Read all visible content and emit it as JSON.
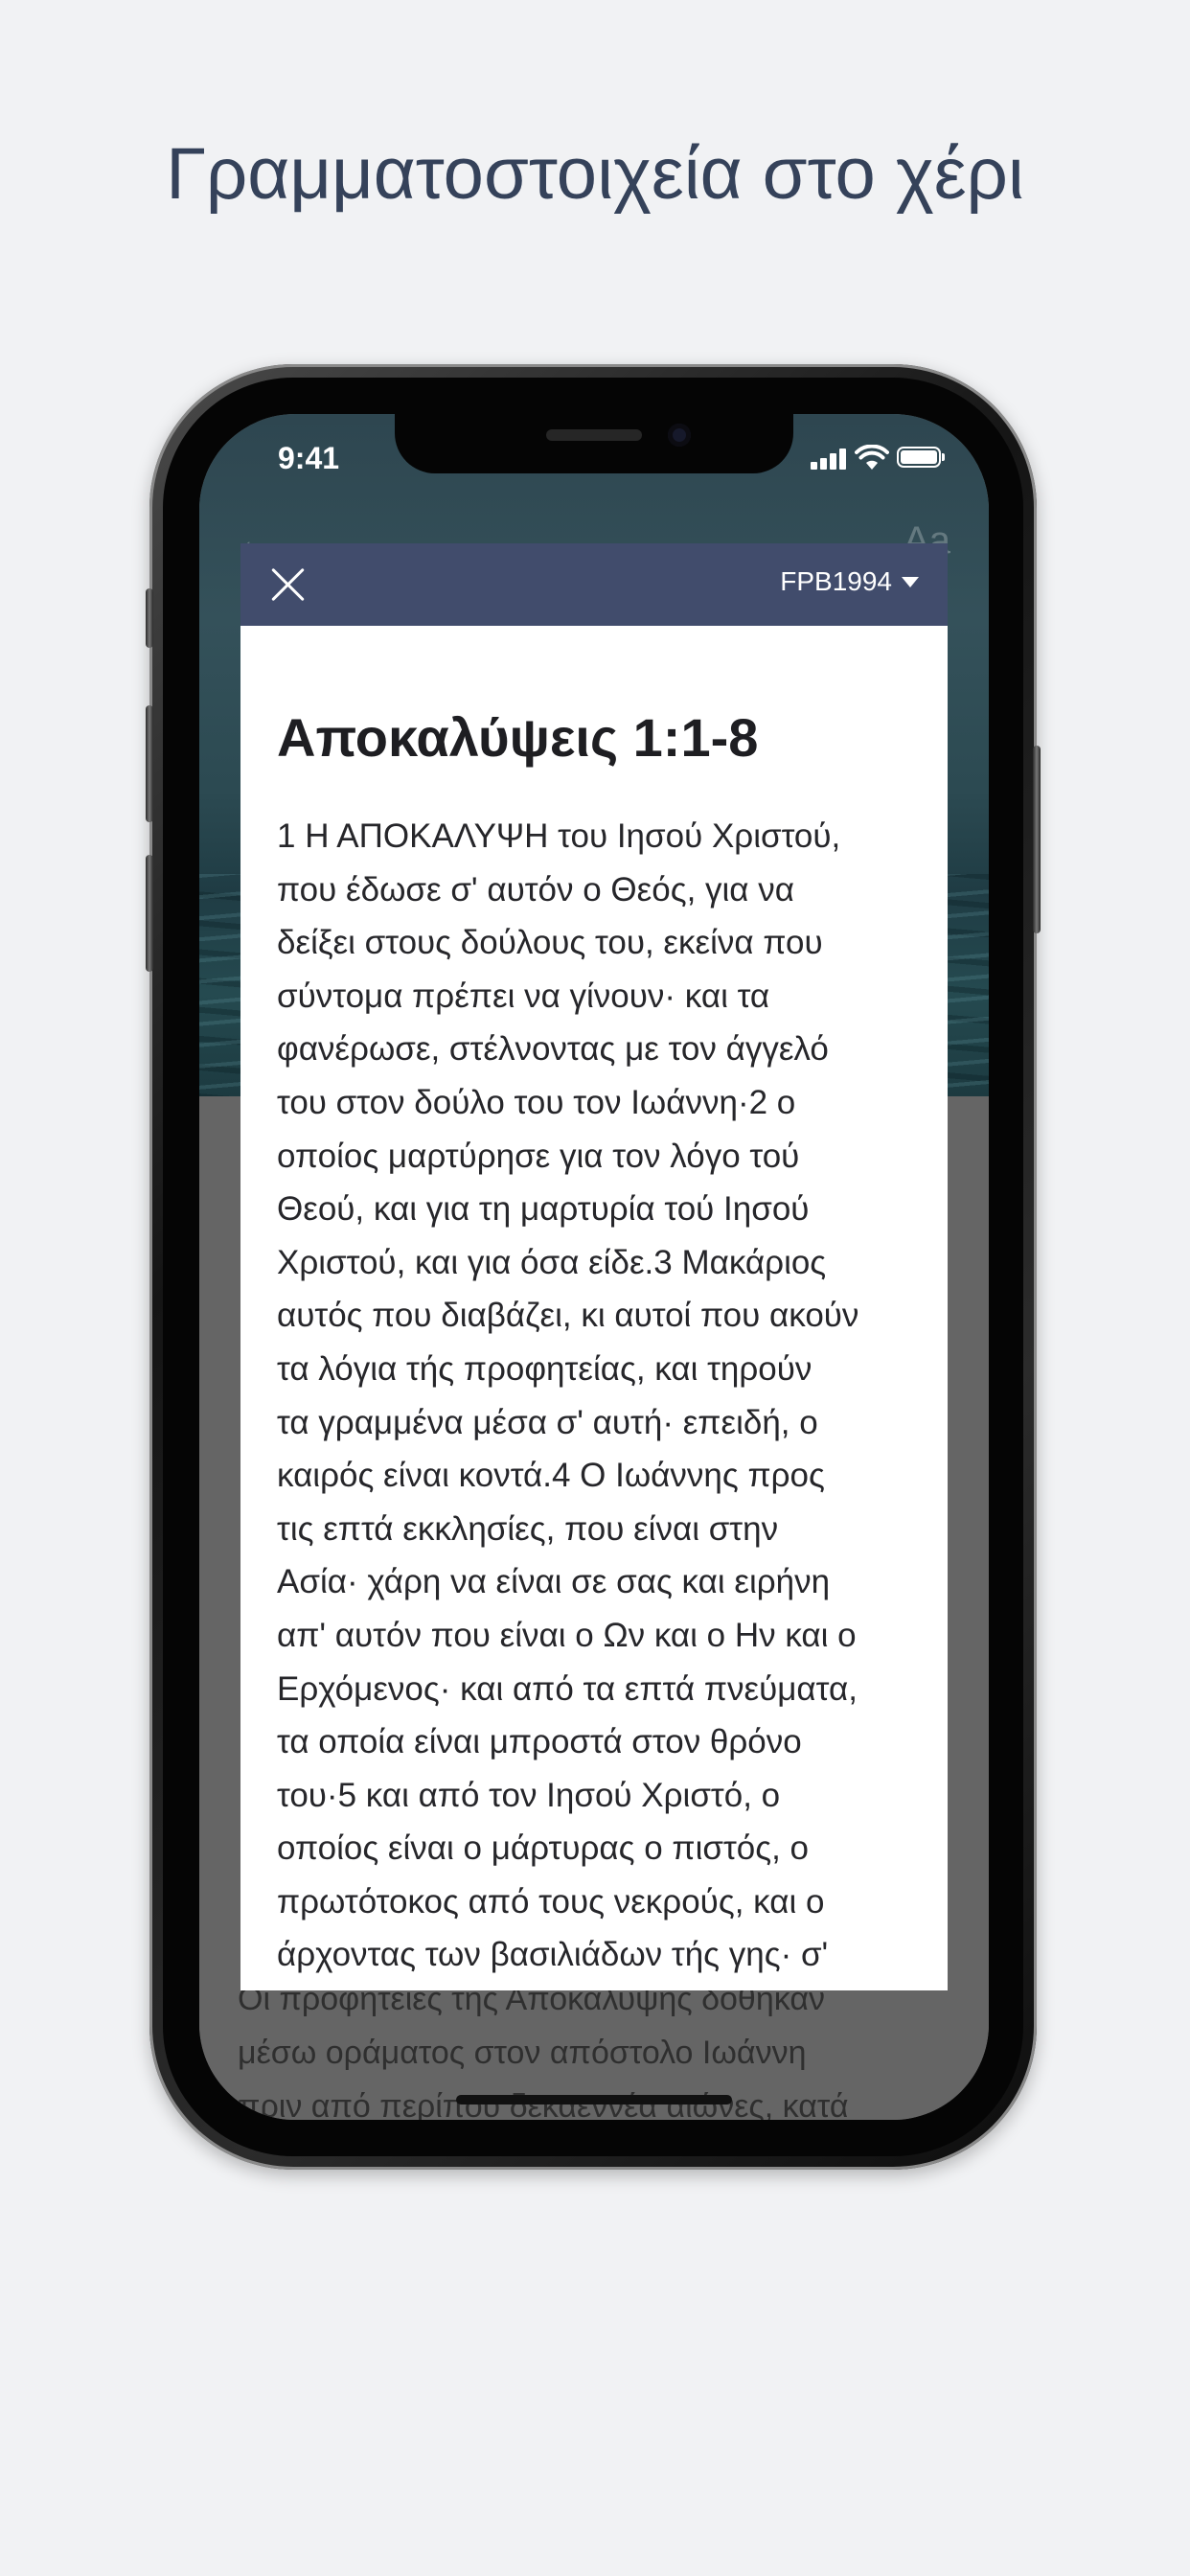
{
  "headline": "Γραμματοστοιχεία στο χέρι",
  "status_bar": {
    "time": "9:41"
  },
  "modal": {
    "version": "FPB1994",
    "title": "Αποκαλύψεις 1:1-8",
    "lines": [
      "1 Η ΑΠΟΚΑΛΥΨΗ του Ιησού Χριστού,",
      "που έδωσε σ' αυτόν ο Θεός, για να",
      "δείξει στους δούλους του, εκείνα που",
      "σύντομα πρέπει να γίνουν· και τα",
      "φανέρωσε, στέλνοντας με τον άγγελό",
      "του στον δούλο του τον Ιωάννη·2 ο",
      "οποίος μαρτύρησε για τον λόγο τού",
      "Θεού, και για τη μαρτυρία τού Ιησού",
      "Χριστού, και για όσα είδε.3 Μακάριος",
      "αυτός που διαβάζει, κι αυτοί που ακούν",
      "τα λόγια τής προφητείας, και τηρούν",
      "τα γραμμένα μέσα σ' αυτή· επειδή, ο",
      "καιρός είναι κοντά.4 Ο Ιωάννης προς",
      "τις επτά εκκλησίες, που είναι στην",
      "Ασία· χάρη να είναι σε σας και ειρήνη",
      "απ' αυτόν που είναι ο Ων και ο Ην και ο",
      "Ερχόμενος· και από τα επτά πνεύματα,",
      "τα οποία είναι μπροστά στον θρόνο",
      "του·5 και από τον Ιησού Χριστό, ο",
      "οποίος είναι ο μάρτυρας ο πιστός, ο",
      "πρωτότοκος από τους νεκρούς, και ο",
      "άρχοντας των βασιλιάδων τής γης· σ'"
    ]
  },
  "background_text": {
    "lines": [
      "Οι προφητείες της Αποκάλυψης δόθηκαν",
      "μέσω οράματος στον απόστολο Ιωάννη",
      "πριν από περίπου δεκαεννέα αιώνες, κατά"
    ]
  }
}
